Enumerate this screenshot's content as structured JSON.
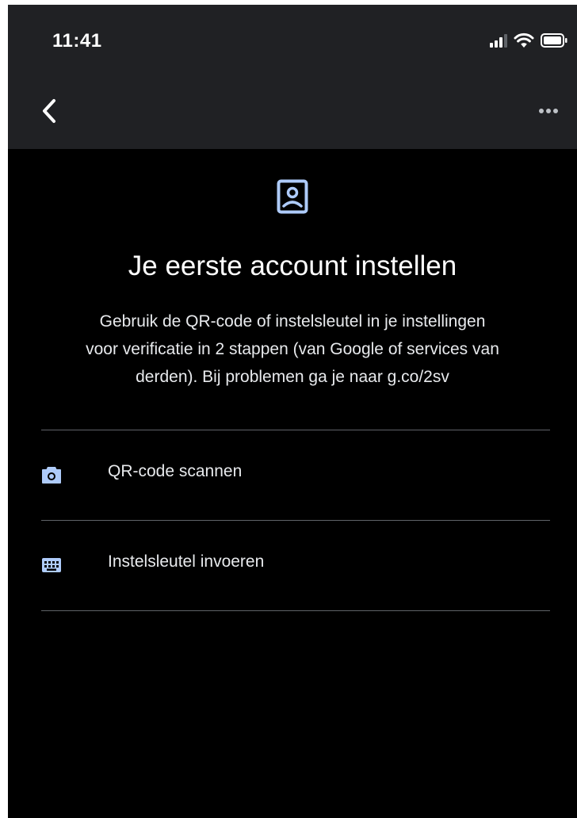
{
  "status_bar": {
    "time": "11:41",
    "icons": [
      "signal-icon",
      "wifi-icon",
      "battery-icon"
    ]
  },
  "nav": {
    "back_icon": "chevron-left-icon",
    "more_icon": "more-horizontal-icon"
  },
  "hero": {
    "icon": "account-box-icon",
    "title": "Je eerste account instellen",
    "description_lines": [
      "Gebruik de QR-code of instelsleutel in je instellingen",
      "voor verificatie in 2 stappen (van Google of services van",
      "derden). Bij problemen ga je naar g.co/2sv"
    ]
  },
  "options": [
    {
      "icon": "camera-icon",
      "label": "QR-code scannen"
    },
    {
      "icon": "keyboard-icon",
      "label": "Instelsleutel invoeren"
    }
  ],
  "colors": {
    "header_bg": "#202124",
    "body_bg": "#000000",
    "accent": "#aecbfa",
    "text": "#e8eaed",
    "divider": "#5f6368"
  }
}
